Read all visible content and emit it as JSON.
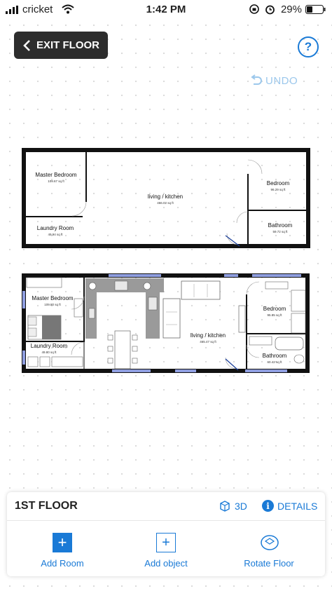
{
  "status_bar": {
    "carrier": "cricket",
    "time": "1:42 PM",
    "battery": "29%"
  },
  "header": {
    "exit_label": "EXIT FLOOR",
    "undo_label": "UNDO"
  },
  "floorplan_top": {
    "rooms": [
      {
        "name": "Master Bedroom",
        "area": "109.67 sq ft"
      },
      {
        "name": "living / kitchen",
        "area": "466.02 sq ft"
      },
      {
        "name": "Bedroom",
        "area": "96.29 sq ft"
      },
      {
        "name": "Laundry Room",
        "area": "49.94 sq ft"
      },
      {
        "name": "Bathroom",
        "area": "59.72 sq ft"
      }
    ]
  },
  "floorplan_bottom": {
    "rooms": [
      {
        "name": "Master Bedroom",
        "area": "109.80 sq ft"
      },
      {
        "name": "living / kitchen",
        "area": "465.47 sq ft"
      },
      {
        "name": "Bedroom",
        "area": "95.85 sq ft"
      },
      {
        "name": "Laundry Room",
        "area": "49.80 sq ft"
      },
      {
        "name": "Bathroom",
        "area": "60.42 sq ft"
      }
    ]
  },
  "panel": {
    "floor_name": "1ST FLOOR",
    "btn_3d": "3D",
    "btn_details": "DETAILS",
    "actions": [
      {
        "label": "Add Room"
      },
      {
        "label": "Add object"
      },
      {
        "label": "Rotate Floor"
      }
    ]
  },
  "colors": {
    "accent": "#1a7ad6",
    "dark_button": "#2d2d2d"
  }
}
